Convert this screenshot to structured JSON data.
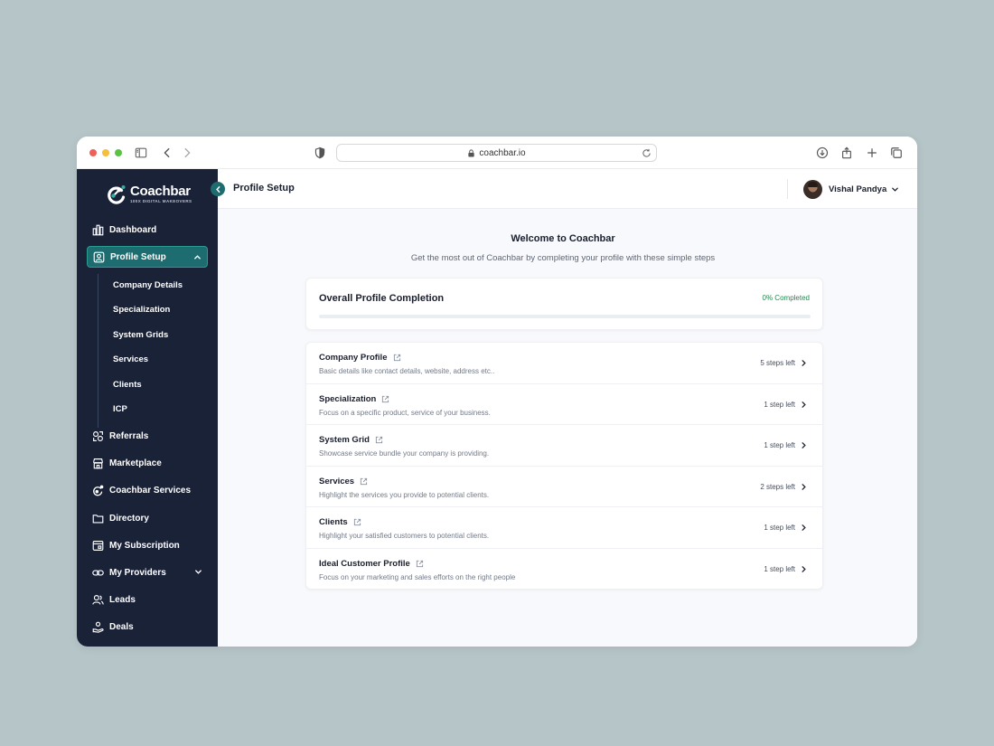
{
  "browser": {
    "url": "coachbar.io"
  },
  "sidebar": {
    "logo": {
      "name": "Coachbar",
      "tagline": "100X DIGITAL MAKEOVERS"
    },
    "items": [
      {
        "label": "Dashboard",
        "icon": "dashboard-icon"
      },
      {
        "label": "Profile Setup",
        "icon": "profile-setup-icon",
        "active": true
      },
      {
        "label": "Referrals",
        "icon": "referrals-icon"
      },
      {
        "label": "Marketplace",
        "icon": "marketplace-icon"
      },
      {
        "label": "Coachbar Services",
        "icon": "coachbar-services-icon"
      },
      {
        "label": "Directory",
        "icon": "folder-icon"
      },
      {
        "label": "My Subscription",
        "icon": "subscription-icon"
      },
      {
        "label": "My Providers",
        "icon": "link-icon"
      },
      {
        "label": "Leads",
        "icon": "leads-icon"
      },
      {
        "label": "Deals",
        "icon": "deals-icon"
      }
    ],
    "sub_items": [
      {
        "label": "Company Details"
      },
      {
        "label": "Specialization"
      },
      {
        "label": "System Grids"
      },
      {
        "label": "Services"
      },
      {
        "label": "Clients"
      },
      {
        "label": "ICP"
      }
    ]
  },
  "header": {
    "title": "Profile Setup",
    "user_name": "Vishal Pandya"
  },
  "main": {
    "welcome_title": "Welcome to Coachbar",
    "welcome_subtitle": "Get the most out of Coachbar by completing your profile with these simple steps",
    "completion": {
      "title": "Overall Profile Completion",
      "status": "0% Completed",
      "percent": 0,
      "color": "#1f8a4c"
    },
    "steps": [
      {
        "title": "Company Profile",
        "desc": "Basic details like contact details, website, address etc..",
        "left": "5 steps left"
      },
      {
        "title": "Specialization",
        "desc": "Focus on a specific product, service of your business.",
        "left": "1 step left"
      },
      {
        "title": "System Grid",
        "desc": "Showcase service bundle your company is providing.",
        "left": "1 step left"
      },
      {
        "title": "Services",
        "desc": "Highlight the services you provide to potential clients.",
        "left": "2 steps left"
      },
      {
        "title": "Clients",
        "desc": "Highlight your satisfied customers to potential clients.",
        "left": "1 step left"
      },
      {
        "title": "Ideal Customer Profile",
        "desc": "Focus on your marketing and sales efforts on the right people",
        "left": "1 step left"
      }
    ]
  },
  "colors": {
    "sidebar_bg": "#1a2238",
    "accent": "#1d6d70",
    "success": "#1f8a4c"
  }
}
